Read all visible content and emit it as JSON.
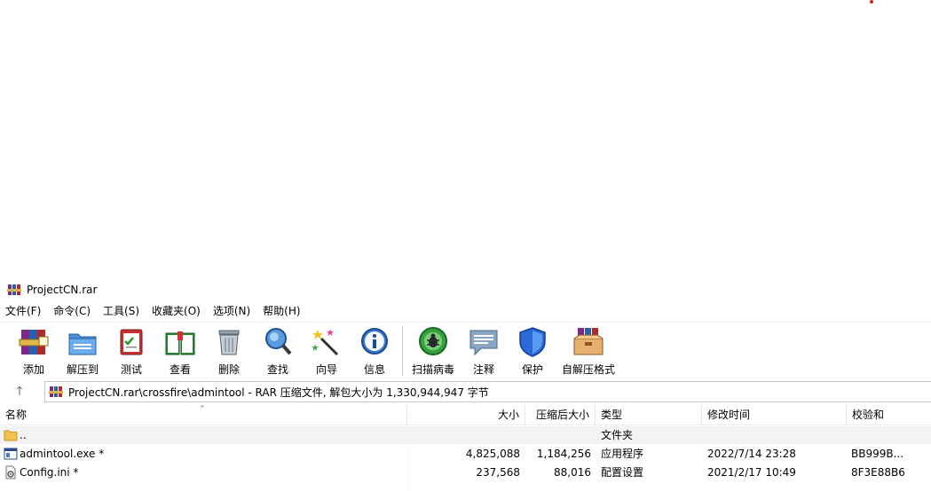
{
  "window": {
    "title": "ProjectCN.rar"
  },
  "menu": [
    {
      "label": "文件(F)"
    },
    {
      "label": "命令(C)"
    },
    {
      "label": "工具(S)"
    },
    {
      "label": "收藏夹(O)"
    },
    {
      "label": "选项(N)"
    },
    {
      "label": "帮助(H)"
    }
  ],
  "toolbar": [
    {
      "label": "添加",
      "icon": "add-archive-icon"
    },
    {
      "label": "解压到",
      "icon": "extract-folder-icon"
    },
    {
      "label": "测试",
      "icon": "test-clipboard-icon"
    },
    {
      "label": "查看",
      "icon": "view-book-icon"
    },
    {
      "label": "删除",
      "icon": "trash-icon"
    },
    {
      "label": "查找",
      "icon": "magnifier-icon"
    },
    {
      "label": "向导",
      "icon": "wizard-wand-icon"
    },
    {
      "label": "信息",
      "icon": "info-icon"
    },
    {
      "label": "扫描病毒",
      "icon": "virus-scan-icon"
    },
    {
      "label": "注释",
      "icon": "comment-icon"
    },
    {
      "label": "保护",
      "icon": "shield-icon"
    },
    {
      "label": "自解压格式",
      "icon": "sfx-box-icon"
    }
  ],
  "address": {
    "text": "ProjectCN.rar\\crossfire\\admintool - RAR 压缩文件, 解包大小为 1,330,944,947 字节"
  },
  "columns": {
    "name": "名称",
    "size": "大小",
    "packed": "压缩后大小",
    "type": "类型",
    "modified": "修改时间",
    "crc": "校验和"
  },
  "files": [
    {
      "name": "..",
      "size": "",
      "packed": "",
      "type": "文件夹",
      "modified": "",
      "crc": "",
      "icon": "folder-icon"
    },
    {
      "name": "admintool.exe *",
      "size": "4,825,088",
      "packed": "1,184,256",
      "type": "应用程序",
      "modified": "2022/7/14 23:28",
      "crc": "BB999B...",
      "icon": "exe-file-icon"
    },
    {
      "name": "Config.ini *",
      "size": "237,568",
      "packed": "88,016",
      "type": "配置设置",
      "modified": "2021/2/17 10:49",
      "crc": "8F3E88B6",
      "icon": "ini-file-icon"
    }
  ]
}
